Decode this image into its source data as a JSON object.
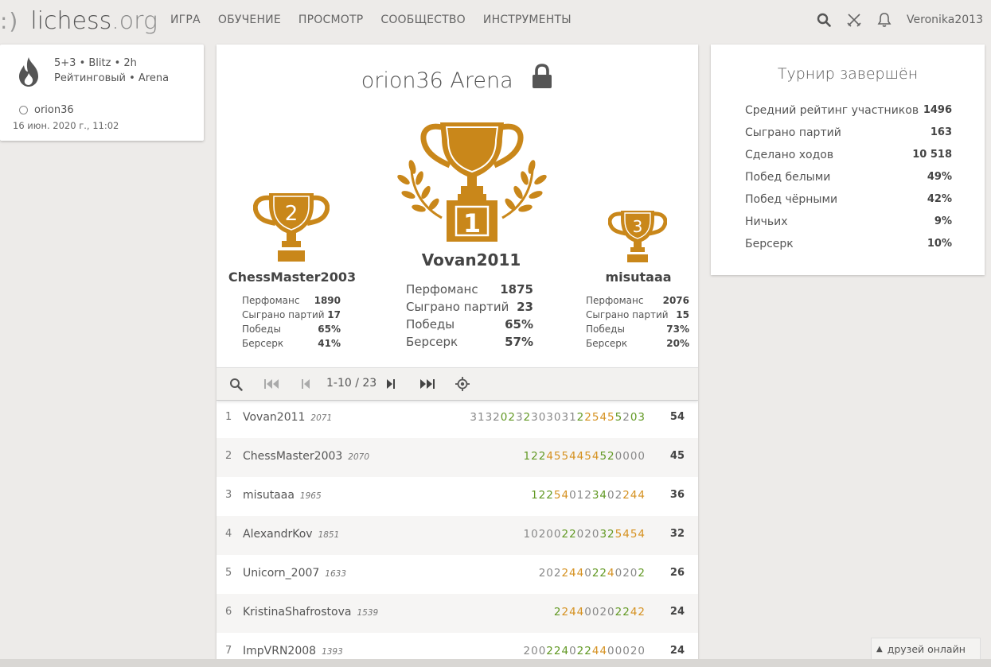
{
  "header": {
    "logo_smile": ":)",
    "logo_name": "lichess",
    "logo_tld": ".org",
    "nav": [
      "ИГРА",
      "ОБУЧЕНИЕ",
      "ПРОСМОТР",
      "СООБЩЕСТВО",
      "ИНСТРУМЕНТЫ"
    ],
    "username": "Veronika2013",
    "icons": [
      "search-icon",
      "swords-icon",
      "bell-icon"
    ]
  },
  "info": {
    "line1": "5+3 • Blitz • 2h",
    "line2": "Рейтинговый • Arena",
    "creator": "orion36",
    "date": "16 июн. 2020 г., 11:02"
  },
  "tournament": {
    "title": "orion36 Arena"
  },
  "podium": {
    "first": {
      "place": "1",
      "name": "Vovan2011",
      "stats": [
        {
          "label": "Перфоманс",
          "value": "1875"
        },
        {
          "label": "Сыграно партий",
          "value": "23"
        },
        {
          "label": "Победы",
          "value": "65%"
        },
        {
          "label": "Берсерк",
          "value": "57%"
        }
      ]
    },
    "second": {
      "place": "2",
      "name": "ChessMaster2003",
      "stats": [
        {
          "label": "Перфоманс",
          "value": "1890"
        },
        {
          "label": "Сыграно партий",
          "value": "17"
        },
        {
          "label": "Победы",
          "value": "65%"
        },
        {
          "label": "Берсерк",
          "value": "41%"
        }
      ]
    },
    "third": {
      "place": "3",
      "name": "misutaaa",
      "stats": [
        {
          "label": "Перфоманс",
          "value": "2076"
        },
        {
          "label": "Сыграно партий",
          "value": "15"
        },
        {
          "label": "Победы",
          "value": "73%"
        },
        {
          "label": "Берсерк",
          "value": "20%"
        }
      ]
    }
  },
  "pager": {
    "info": "1-10 / 23"
  },
  "standings": [
    {
      "rank": "1",
      "name": "Vovan2011",
      "rating": "2071",
      "scores": "313202323030312254552003",
      "total": "54"
    },
    {
      "rank": "2",
      "name": "ChessMaster2003",
      "rating": "2070",
      "scores": "1224554454520000",
      "total": "45"
    },
    {
      "rank": "3",
      "name": "misutaaa",
      "rating": "1965",
      "scores": "122540123402244",
      "total": "36"
    },
    {
      "rank": "4",
      "name": "AlexandrKov",
      "rating": "1851",
      "scores": "102002202032545 4",
      "total": "32"
    },
    {
      "rank": "5",
      "name": "Unicorn_2007",
      "rating": "1633",
      "scores": "2022440224020 2",
      "total": "26"
    },
    {
      "rank": "6",
      "name": "KristinaShafrostova",
      "rating": "1539",
      "scores": "2244002022 42",
      "total": "24"
    },
    {
      "rank": "7",
      "name": "ImpVRN2008",
      "rating": "1393",
      "scores": "20022402244000 20",
      "total": "24"
    }
  ],
  "summary": {
    "title": "Турнир завершён",
    "rows": [
      {
        "label": "Средний рейтинг участников",
        "value": "1496"
      },
      {
        "label": "Сыграно партий",
        "value": "163"
      },
      {
        "label": "Сделано ходов",
        "value": "10 518"
      },
      {
        "label": "Побед белыми",
        "value": "49%"
      },
      {
        "label": "Побед чёрными",
        "value": "42%"
      },
      {
        "label": "Ничьих",
        "value": "9%"
      },
      {
        "label": "Берсерк",
        "value": "10%"
      }
    ]
  },
  "friends": {
    "label": "друзей онлайн"
  },
  "colors": {
    "trophy": "#c9871a",
    "win_streak": "#d59120",
    "win": "#629924",
    "neutral": "#888888"
  }
}
